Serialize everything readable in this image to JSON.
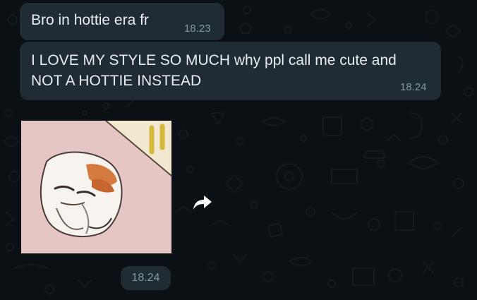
{
  "messages": [
    {
      "text": "Bro in hottie era fr",
      "time": "18.23"
    },
    {
      "text": "I LOVE MY STYLE SO MUCH why ppl call me cute and NOT A HOTTIE INSTEAD",
      "time": "18.24"
    }
  ],
  "sticker": {
    "icon": "hamster-meme-sticker",
    "time": "18.24"
  },
  "forward_button": {
    "icon": "forward-arrow-icon"
  },
  "colors": {
    "chat_background": "#0b1014",
    "bubble": "#1f2c34",
    "message_text": "#e9edef",
    "timestamp": "#8696a0"
  }
}
